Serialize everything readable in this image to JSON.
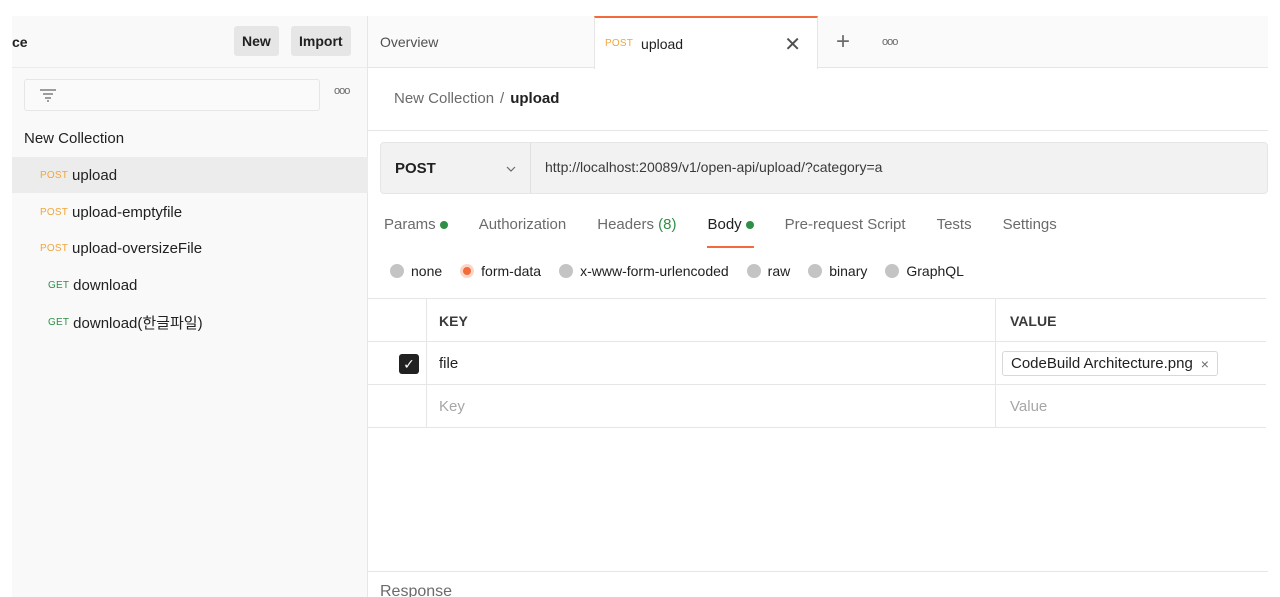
{
  "sidebar": {
    "workspace_title": "ce",
    "new_label": "New",
    "import_label": "Import",
    "more_label": "ooo",
    "collection_name": "New Collection",
    "requests": [
      {
        "method": "POST",
        "name": "upload"
      },
      {
        "method": "POST",
        "name": "upload-emptyfile"
      },
      {
        "method": "POST",
        "name": "upload-oversizeFile"
      },
      {
        "method": "GET",
        "name": "download"
      },
      {
        "method": "GET",
        "name": "download(한글파일)"
      }
    ]
  },
  "tabs": {
    "overview_label": "Overview",
    "active_method": "POST",
    "active_label": "upload",
    "close_label": "✕",
    "plus_label": "+",
    "more_label": "ooo"
  },
  "breadcrumb": {
    "collection": "New Collection",
    "separator": "/",
    "current": "upload"
  },
  "request": {
    "method": "POST",
    "url": "http://localhost:20089/v1/open-api/upload/?category=a"
  },
  "request_tabs": {
    "params": "Params",
    "authorization": "Authorization",
    "headers": "Headers",
    "headers_count": "(8)",
    "body": "Body",
    "pre_request": "Pre-request Script",
    "tests": "Tests",
    "settings": "Settings"
  },
  "body_types": {
    "none": "none",
    "form_data": "form-data",
    "urlencoded": "x-www-form-urlencoded",
    "raw": "raw",
    "binary": "binary",
    "graphql": "GraphQL"
  },
  "kv_table": {
    "key_header": "KEY",
    "value_header": "VALUE",
    "row_key": "file",
    "row_value": "CodeBuild Architecture.png",
    "remove_label": "×",
    "key_placeholder": "Key",
    "value_placeholder": "Value"
  },
  "response_label": "Response",
  "colors": {
    "accent": "#f26b3a",
    "post": "#f2a53a",
    "get": "#2f8f46"
  }
}
